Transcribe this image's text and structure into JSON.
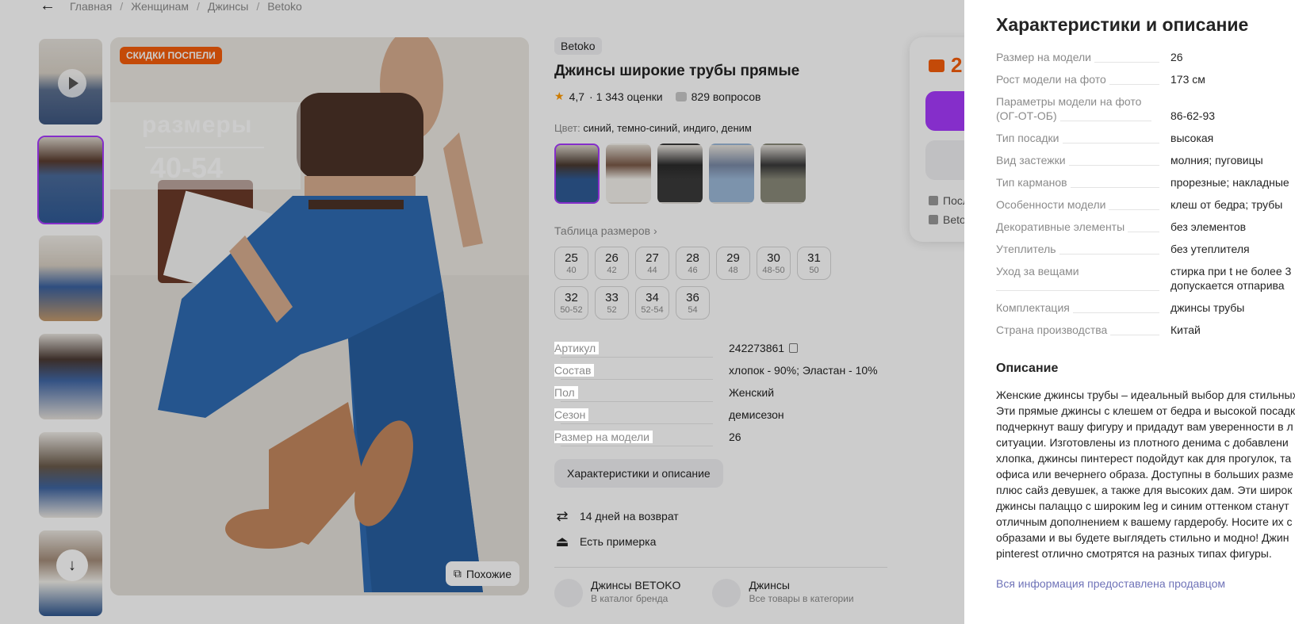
{
  "breadcrumbs": [
    "Главная",
    "Женщинам",
    "Джинсы",
    "Betoko"
  ],
  "main_photo": {
    "badge": "СКИДКИ ПОСПЕЛИ",
    "banner_line1": "размеры",
    "banner_line2": "40-54",
    "similar_label": "Похожие"
  },
  "product": {
    "brand": "Betoko",
    "title": "Джинсы широкие трубы прямые",
    "rating": "4,7",
    "ratings_count": "· 1 343 оценки",
    "questions": "829 вопросов",
    "color_label": "Цвет:",
    "color_value": "синий, темно-синий, индиго, деним",
    "size_table_label": "Таблица размеров",
    "sizes": [
      {
        "ru": "25",
        "eu": "40"
      },
      {
        "ru": "26",
        "eu": "42"
      },
      {
        "ru": "27",
        "eu": "44"
      },
      {
        "ru": "28",
        "eu": "46"
      },
      {
        "ru": "29",
        "eu": "48"
      },
      {
        "ru": "30",
        "eu": "48-50"
      },
      {
        "ru": "31",
        "eu": "50"
      },
      {
        "ru": "32",
        "eu": "50-52"
      },
      {
        "ru": "33",
        "eu": "52"
      },
      {
        "ru": "34",
        "eu": "52-54"
      },
      {
        "ru": "36",
        "eu": "54"
      }
    ],
    "short_specs": [
      {
        "k": "Артикул",
        "v": "242273861"
      },
      {
        "k": "Состав",
        "v": "хлопок - 90%; Эластан - 10%"
      },
      {
        "k": "Пол",
        "v": "Женский"
      },
      {
        "k": "Сезон",
        "v": "демисезон"
      },
      {
        "k": "Размер на модели",
        "v": "26"
      }
    ],
    "chars_button": "Характеристики и описание",
    "perk_return": "14 дней на возврат",
    "perk_fitting": "Есть примерка",
    "link_brand_title": "Джинсы BETOKO",
    "link_brand_sub": "В каталог бренда",
    "link_cat_title": "Джинсы",
    "link_cat_sub": "Все товары в категории"
  },
  "price_card": {
    "price": "2",
    "delivery1": "Посл",
    "delivery2": "Beto"
  },
  "panel": {
    "title": "Характеристики и описание",
    "rows": [
      {
        "k": "Размер на модели",
        "v": "26"
      },
      {
        "k": "Рост модели на фото",
        "v": "173 см"
      },
      {
        "k": "Параметры модели на фото (ОГ-ОТ-ОБ)",
        "v": "86-62-93"
      },
      {
        "k": "Тип посадки",
        "v": "высокая"
      },
      {
        "k": "Вид застежки",
        "v": "молния; пуговицы"
      },
      {
        "k": "Тип карманов",
        "v": "прорезные; накладные"
      },
      {
        "k": "Особенности модели",
        "v": "клеш от бедра; трубы"
      },
      {
        "k": "Декоративные элементы",
        "v": "без элементов"
      },
      {
        "k": "Утеплитель",
        "v": "без утеплителя"
      },
      {
        "k": "Уход за вещами",
        "v": "стирка при t не более 3",
        "v2": "допускается отпарива"
      },
      {
        "k": "Комплектация",
        "v": "джинсы трубы"
      },
      {
        "k": "Страна производства",
        "v": "Китай"
      }
    ],
    "description_title": "Описание",
    "description_lines": [
      "Женские джинсы трубы – идеальный выбор для стильных",
      "Эти прямые джинсы с клешем от бедра и высокой посадк",
      "подчеркнут вашу фигуру и придадут вам уверенности в л",
      "ситуации. Изготовлены из плотного денима с добавлени",
      "хлопка, джинсы пинтерест подойдут как для прогулок, та",
      "офиса или вечернего образа. Доступны в больших разме",
      "плюс сайз девушек, а также для высоких дам. Эти широк",
      "джинсы палаццо с широким leg и синим оттенком станут",
      "отличным дополнением к вашему гардеробу. Носите их с",
      "образами и вы будете выглядеть стильно и модно! Джин",
      "pinterest отлично смотрятся на разных типах фигуры."
    ],
    "seller_link": "Вся информация предоставлена продавцом"
  },
  "colors": {
    "accent": "#a73afd",
    "sale": "#f55d0b",
    "muted": "#8b8b8b"
  }
}
